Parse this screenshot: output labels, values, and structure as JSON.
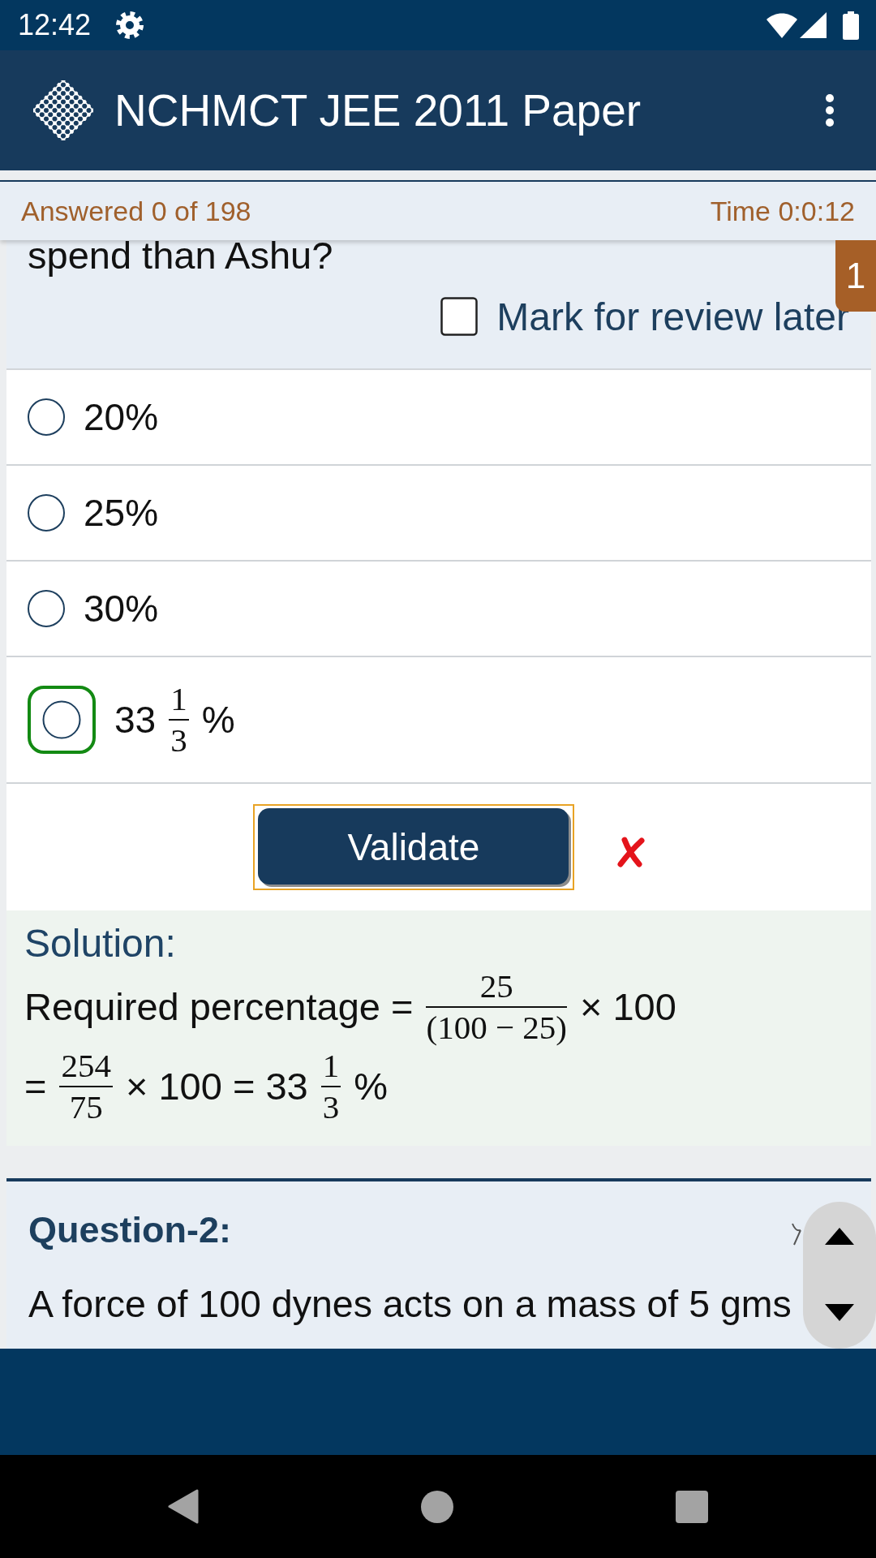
{
  "status_bar": {
    "time": "12:42"
  },
  "app_bar": {
    "title": "NCHMCT JEE 2011 Paper"
  },
  "quiz_info": {
    "answered": "Answered 0 of 198",
    "time": "Time 0:0:12"
  },
  "question": {
    "number": "1",
    "text": "spend than Ashu?",
    "mark_for_review": {
      "label": "Mark for review later",
      "checked": false
    },
    "options": [
      {
        "selected": false,
        "correct": false,
        "segments": [
          {
            "kind": "text",
            "text": "20%"
          }
        ]
      },
      {
        "selected": false,
        "correct": false,
        "segments": [
          {
            "kind": "text",
            "text": "25%"
          }
        ]
      },
      {
        "selected": false,
        "correct": false,
        "segments": [
          {
            "kind": "text",
            "text": "30%"
          }
        ]
      },
      {
        "selected": false,
        "correct": true,
        "segments": [
          {
            "kind": "text",
            "text": "33"
          },
          {
            "kind": "fraction",
            "numerator": "1",
            "denominator": "3"
          },
          {
            "kind": "text",
            "text": "%"
          }
        ]
      }
    ],
    "validate_button": "Validate",
    "validation": {
      "correct": false
    },
    "solution": {
      "heading": "Solution:",
      "lines": [
        [
          {
            "kind": "text",
            "text": "Required percentage ="
          },
          {
            "kind": "fraction",
            "numerator": "25",
            "denominator": "(100 − 25)"
          },
          {
            "kind": "text",
            "text": "× 100"
          }
        ],
        [
          {
            "kind": "text",
            "text": "="
          },
          {
            "kind": "fraction",
            "numerator": "254",
            "denominator": "75"
          },
          {
            "kind": "text",
            "text": "× 100 = 33"
          },
          {
            "kind": "fraction",
            "numerator": "1",
            "denominator": "3"
          },
          {
            "kind": "text",
            "text": "%"
          }
        ]
      ]
    }
  },
  "next_question": {
    "heading": "Question-2:",
    "text": "A force of 100 dynes acts on a mass of 5 gms"
  }
}
